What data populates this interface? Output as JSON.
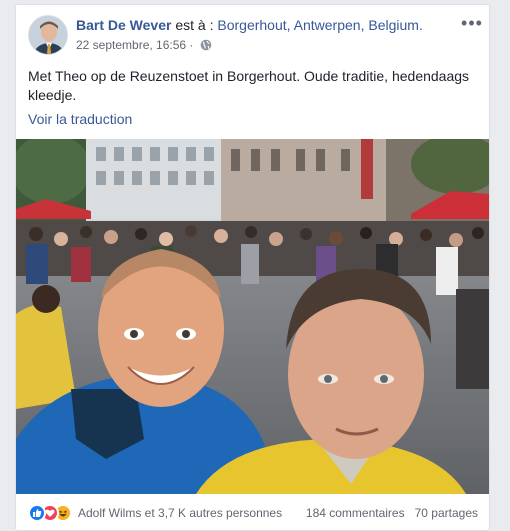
{
  "post": {
    "author": "Bart De Wever",
    "location_prefix": " est à : ",
    "location": "Borgerhout, Antwerpen, Belgium.",
    "timestamp": "22 septembre, 16:56 · ",
    "privacy_icon": "globe-icon",
    "more_icon": "more-options-icon",
    "text": "Met Theo op de Reuzenstoet in Borgerhout. Oude traditie, hedendaags kleedje.",
    "translate_label": "Voir la traduction"
  },
  "footer": {
    "reaction_icons": [
      "like-reaction-icon",
      "love-reaction-icon",
      "haha-reaction-icon"
    ],
    "reactors": "Adolf Wilms et 3,7 K autres personnes",
    "comments": "184 commentaires",
    "shares": "70 partages"
  },
  "colors": {
    "link": "#385898",
    "text": "#1d2129",
    "muted": "#616770",
    "like": "#1877f2",
    "love": "#f33e58",
    "haha": "#f7b125"
  }
}
